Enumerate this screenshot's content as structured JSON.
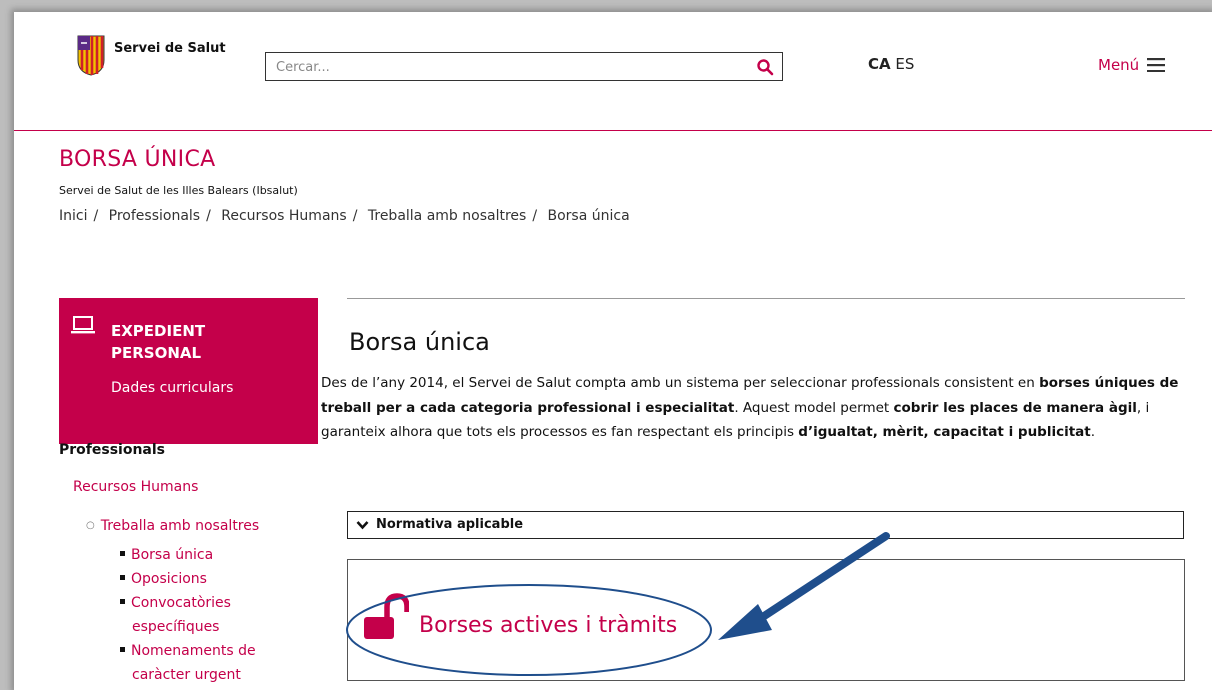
{
  "header": {
    "logo_text": "Servei de Salut",
    "search_placeholder": "Cercar...",
    "lang_ca": "CA",
    "lang_es": "ES",
    "menu_label": "Menú",
    "accent_color": "#c4004a"
  },
  "title_area": {
    "page_title": "BORSA ÚNICA",
    "subtitle": "Servei de Salut de les Illes Balears (Ibsalut)",
    "breadcrumb": [
      "Inici",
      "Professionals",
      "Recursos Humans",
      "Treballa amb nosaltres",
      "Borsa única"
    ]
  },
  "sidebar": {
    "expedient_title": "EXPEDIENT PERSONAL",
    "expedient_link": "Dades curriculars",
    "heading": "Professionals",
    "section": "Recursos Humans",
    "subsection": "Treballa amb nosaltres",
    "items": [
      "Borsa única",
      "Oposicions",
      "Convocatòries",
      "específiques",
      "Nomenaments de",
      "caràcter urgent"
    ]
  },
  "main": {
    "title": "Borsa única",
    "intro_parts": [
      "Des de l’any 2014, el Servei de Salut compta amb un sistema per seleccionar professionals consistent en ",
      "borses úniques de treball per a cada categoria professional i especialitat",
      ". Aquest model permet ",
      "cobrir les places de manera àgil",
      ", i garanteix alhora que tots els processos es fan respectant els principis ",
      "d’igualtat, mèrit, capacitat i publicitat",
      "."
    ],
    "normativa_label": "Normativa aplicable",
    "borses_link": "Borses actives i tràmits"
  },
  "icons": {
    "search": "search-icon",
    "menu": "hamburger-icon",
    "laptop": "laptop-icon",
    "chevron": "chevron-down-icon",
    "lock": "unlocked-padlock-icon"
  }
}
